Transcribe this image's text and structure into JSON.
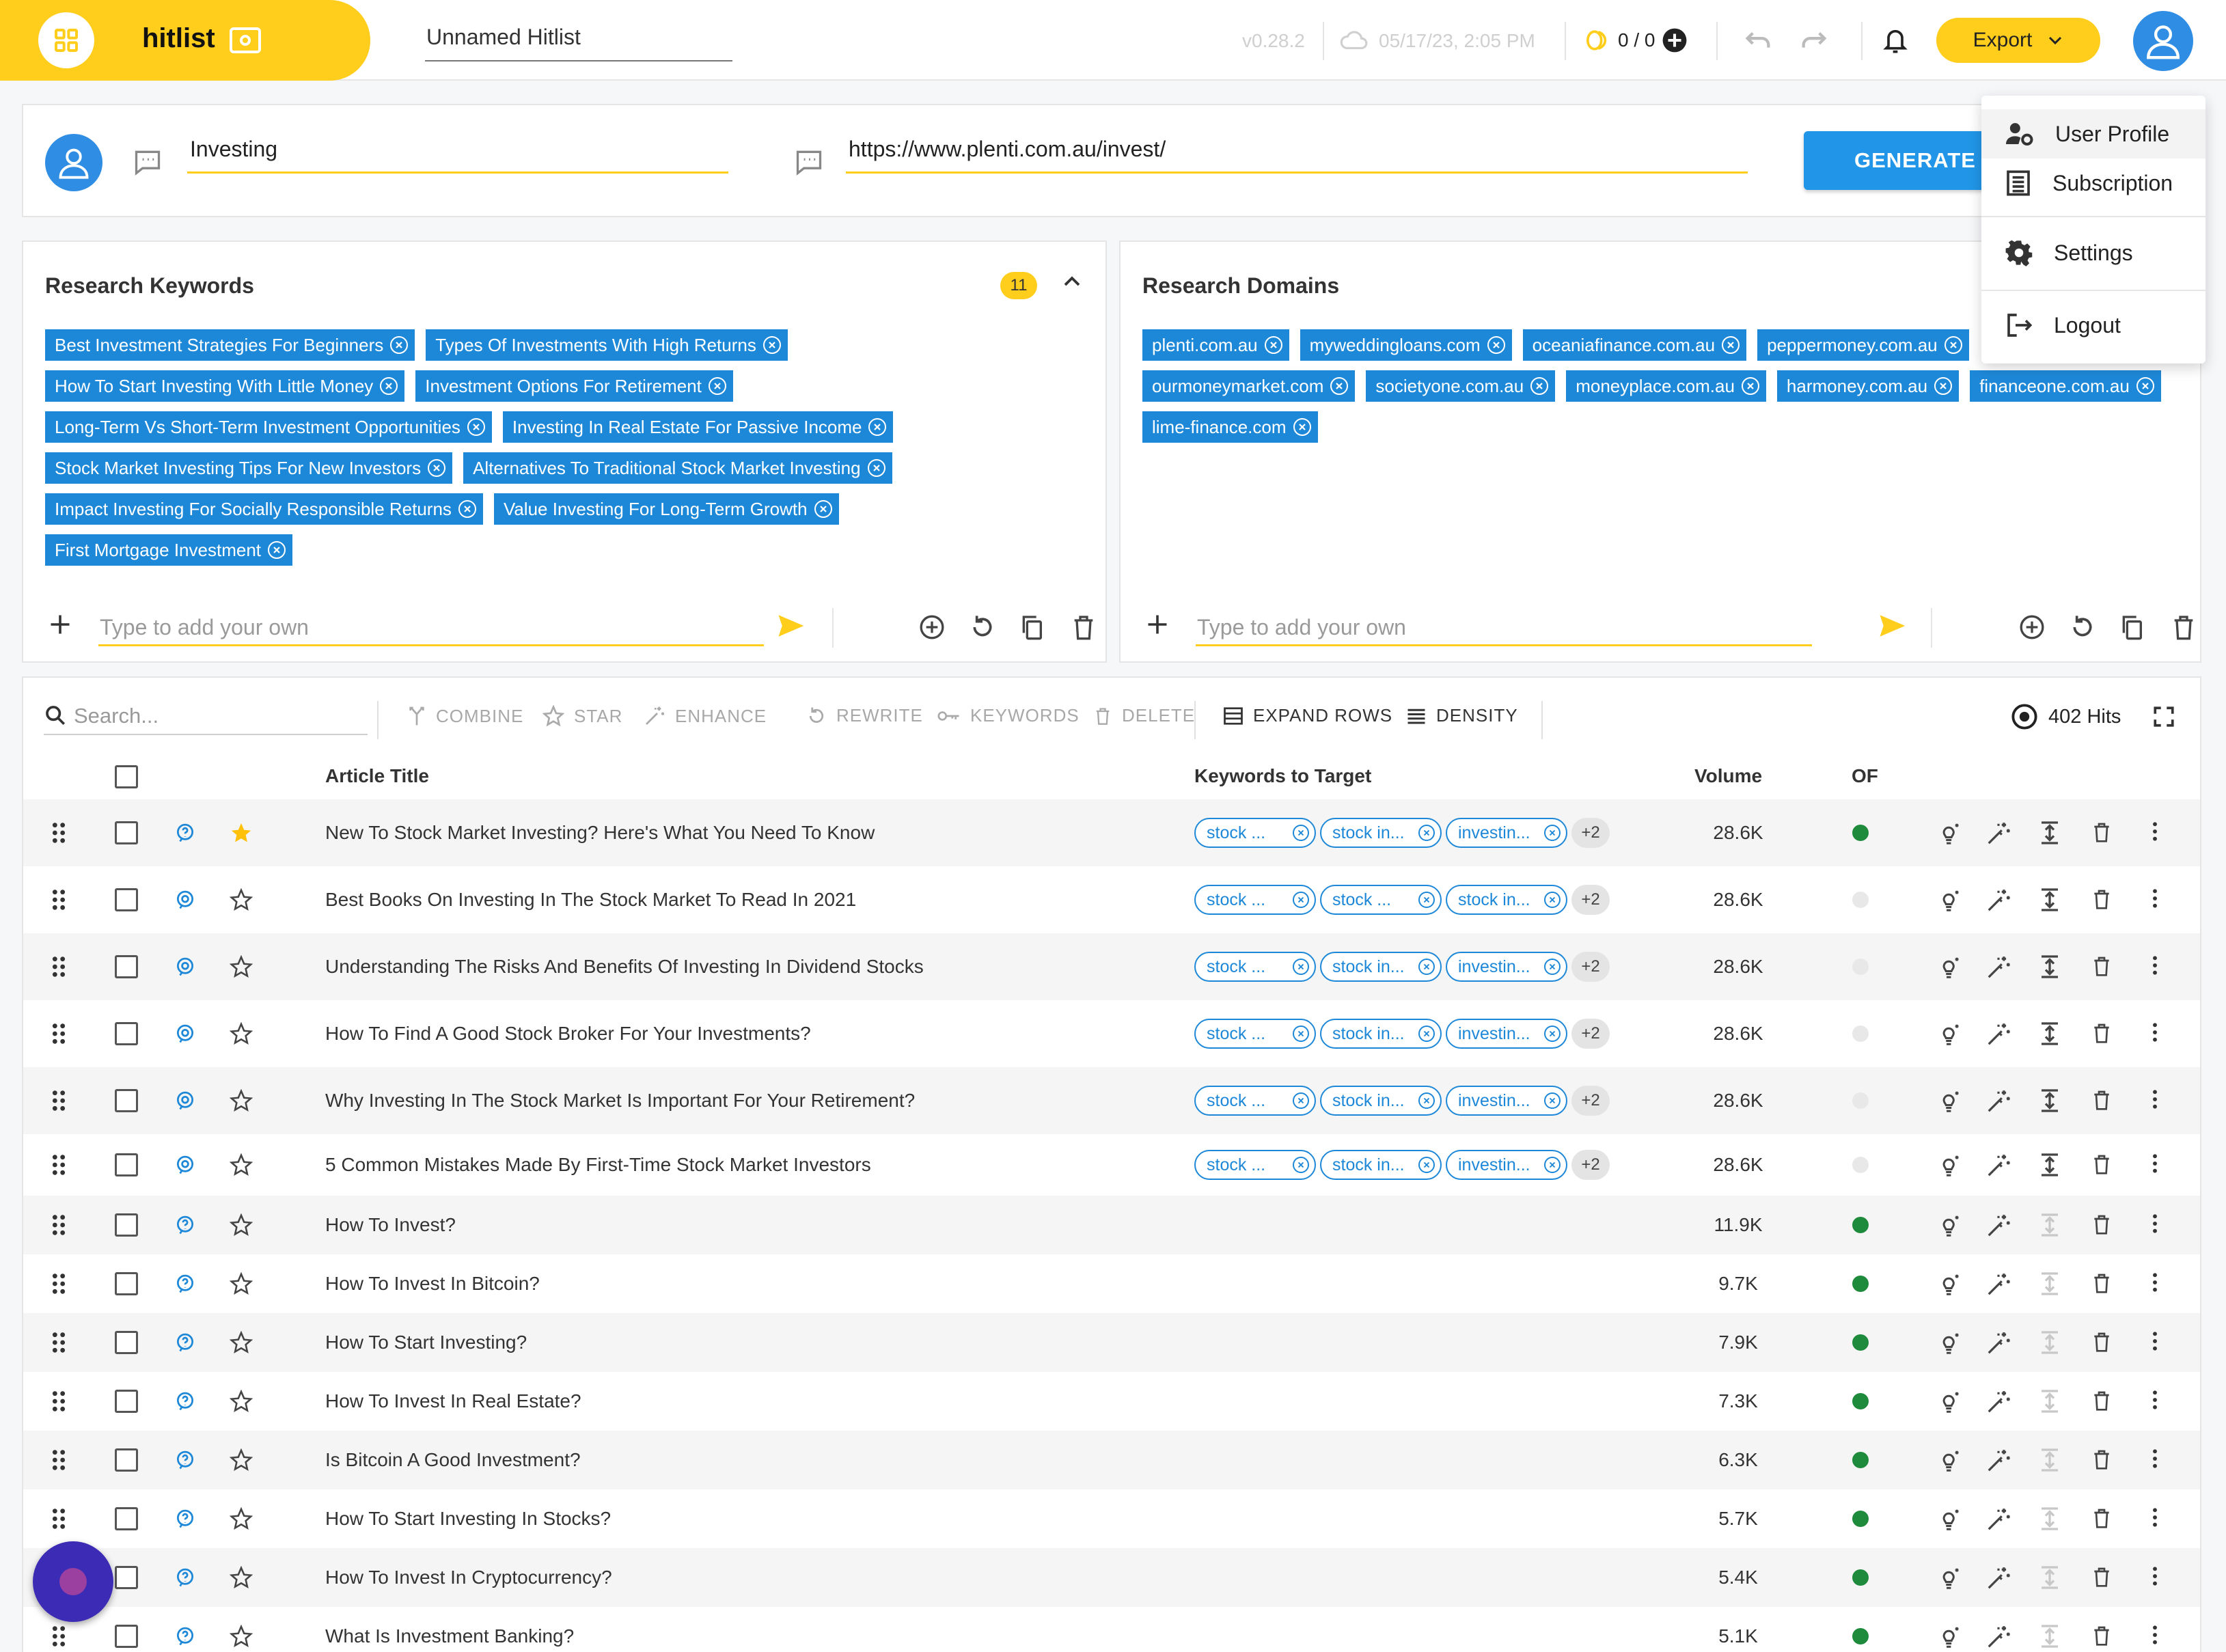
{
  "app": {
    "name": "hitlist",
    "hitlist_name": "Unnamed Hitlist",
    "version": "v0.28.2",
    "saved_at": "05/17/23, 2:05 PM",
    "credits": "0 / 0",
    "export_label": "Export"
  },
  "colors": {
    "brand": "#ffcd1c",
    "primary": "#1e88d8",
    "success": "#1e8a3c",
    "muted_dot": "#e8e8e8"
  },
  "generator": {
    "topic": "Investing",
    "url": "https://www.plenti.com.au/invest/",
    "button": "GENERATE"
  },
  "keywords_panel": {
    "title": "Research Keywords",
    "count": "11",
    "placeholder": "Type to add your own",
    "chips": [
      "Best Investment Strategies For Beginners",
      "Types Of Investments With High Returns",
      "How To Start Investing With Little Money",
      "Investment Options For Retirement",
      "Long-Term Vs Short-Term Investment Opportunities",
      "Investing In Real Estate For Passive Income",
      "Stock Market Investing Tips For New Investors",
      "Alternatives To Traditional Stock Market Investing",
      "Impact Investing For Socially Responsible Returns",
      "Value Investing For Long-Term Growth",
      "First Mortgage Investment"
    ]
  },
  "domains_panel": {
    "title": "Research Domains",
    "placeholder": "Type to add your own",
    "chips": [
      "plenti.com.au",
      "myweddingloans.com",
      "oceaniafinance.com.au",
      "peppermoney.com.au",
      "ourmoneymarket.com",
      "societyone.com.au",
      "moneyplace.com.au",
      "harmoney.com.au",
      "financeone.com.au",
      "lime-finance.com"
    ]
  },
  "toolbar": {
    "search_placeholder": "Search...",
    "combine": "COMBINE",
    "star": "STAR",
    "enhance": "ENHANCE",
    "rewrite": "REWRITE",
    "keywords": "KEYWORDS",
    "delete": "DELETE",
    "expand_rows": "EXPAND ROWS",
    "density": "DENSITY",
    "hits": "402 Hits"
  },
  "table": {
    "headers": {
      "title": "Article Title",
      "keywords": "Keywords to Target",
      "volume": "Volume",
      "of": "OF"
    },
    "rows": [
      {
        "title": "New To Stock Market Investing? Here's What You Need To Know",
        "keywords": [
          "stock ...",
          "stock in...",
          "investin..."
        ],
        "more": "+2",
        "volume": "28.6K",
        "of": true,
        "starred": true
      },
      {
        "title": "Best Books On Investing In The Stock Market To Read In 2021",
        "keywords": [
          "stock ...",
          "stock ...",
          "stock in..."
        ],
        "more": "+2",
        "volume": "28.6K",
        "of": false,
        "starred": false
      },
      {
        "title": "Understanding The Risks And Benefits Of Investing In Dividend Stocks",
        "keywords": [
          "stock ...",
          "stock in...",
          "investin..."
        ],
        "more": "+2",
        "volume": "28.6K",
        "of": false,
        "starred": false
      },
      {
        "title": "How To Find A Good Stock Broker For Your Investments?",
        "keywords": [
          "stock ...",
          "stock in...",
          "investin..."
        ],
        "more": "+2",
        "volume": "28.6K",
        "of": false,
        "starred": false
      },
      {
        "title": "Why Investing In The Stock Market Is Important For Your Retirement?",
        "keywords": [
          "stock ...",
          "stock in...",
          "investin..."
        ],
        "more": "+2",
        "volume": "28.6K",
        "of": false,
        "starred": false
      },
      {
        "title": "5 Common Mistakes Made By First-Time Stock Market Investors",
        "keywords": [
          "stock ...",
          "stock in...",
          "investin..."
        ],
        "more": "+2",
        "volume": "28.6K",
        "of": false,
        "starred": false
      },
      {
        "title": "How To Invest?",
        "keywords": [],
        "more": "",
        "volume": "11.9K",
        "of": true,
        "starred": false
      },
      {
        "title": "How To Invest In Bitcoin?",
        "keywords": [],
        "more": "",
        "volume": "9.7K",
        "of": true,
        "starred": false
      },
      {
        "title": "How To Start Investing?",
        "keywords": [],
        "more": "",
        "volume": "7.9K",
        "of": true,
        "starred": false
      },
      {
        "title": "How To Invest In Real Estate?",
        "keywords": [],
        "more": "",
        "volume": "7.3K",
        "of": true,
        "starred": false
      },
      {
        "title": "Is Bitcoin A Good Investment?",
        "keywords": [],
        "more": "",
        "volume": "6.3K",
        "of": true,
        "starred": false
      },
      {
        "title": "How To Start Investing In Stocks?",
        "keywords": [],
        "more": "",
        "volume": "5.7K",
        "of": true,
        "starred": false
      },
      {
        "title": "How To Invest In Cryptocurrency?",
        "keywords": [],
        "more": "",
        "volume": "5.4K",
        "of": true,
        "starred": false
      },
      {
        "title": "What Is Investment Banking?",
        "keywords": [],
        "more": "",
        "volume": "5.1K",
        "of": true,
        "starred": false
      }
    ]
  },
  "user_menu": {
    "profile": "User Profile",
    "subscription": "Subscription",
    "settings": "Settings",
    "logout": "Logout"
  }
}
